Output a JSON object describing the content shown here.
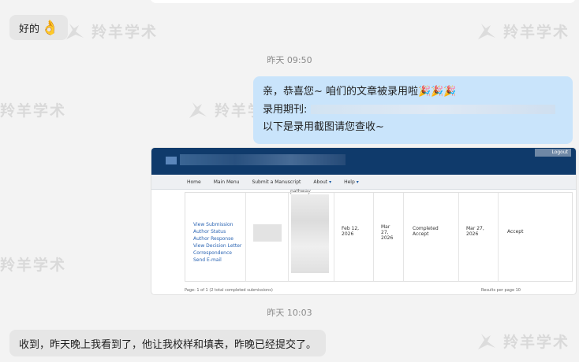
{
  "watermark": "羚羊学术",
  "messages": {
    "first_left": {
      "text": "好的",
      "emoji": "👌"
    },
    "time1": "昨天 09:50",
    "right_bubble": {
      "line1": "亲，恭喜您~ 咱们的文章被录用啦",
      "line1_emoji": "🎉🎉🎉",
      "line2": "录用期刊:",
      "line3": "以下是录用截图请您查收~"
    },
    "time2": "昨天 10:03",
    "last_left": {
      "text": "收到，昨天晚上我看到了，他让我校样和填表，昨晚已经提交了。"
    }
  },
  "screenshot": {
    "logout": "Logout",
    "nav": [
      "Home",
      "Main Menu",
      "Submit a Manuscript",
      "About",
      "Help"
    ],
    "pathway": "pathway",
    "links": [
      "View Submission",
      "Author Status",
      "Author Response",
      "View Decision Letter",
      "Correspondence",
      "Send E-mail"
    ],
    "date1": "Feb 12, 2026",
    "date2": "Mar 27, 2026",
    "status": "Completed Accept",
    "date3": "Mar 27, 2026",
    "decision": "Accept",
    "footer_left": "Page: 1 of 1 (2 total completed submissions)",
    "footer_right": "Results per page",
    "per_page": "10"
  }
}
